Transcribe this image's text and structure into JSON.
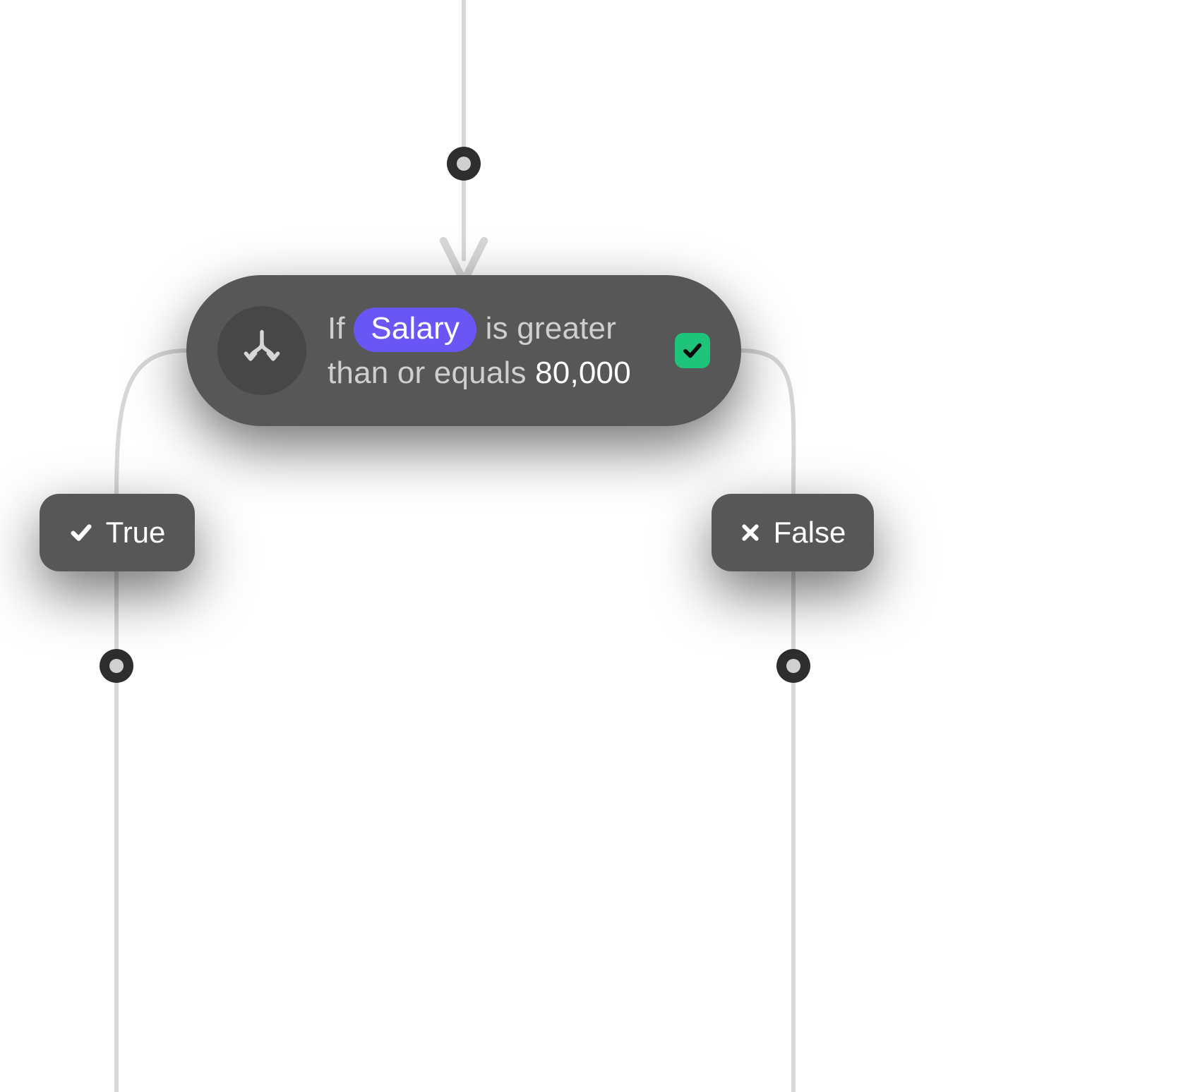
{
  "condition": {
    "prefix": "If",
    "variable": "Salary",
    "mid_phrase_1": "is greater",
    "mid_phrase_2": "than or equals",
    "value": "80,000",
    "status": "ok"
  },
  "branches": {
    "true": {
      "label": "True"
    },
    "false": {
      "label": "False"
    }
  },
  "colors": {
    "node_bg": "#575757",
    "chip_bg": "#6a56f5",
    "check_bg": "#1fc47b",
    "wire": "#d7d7d7"
  }
}
